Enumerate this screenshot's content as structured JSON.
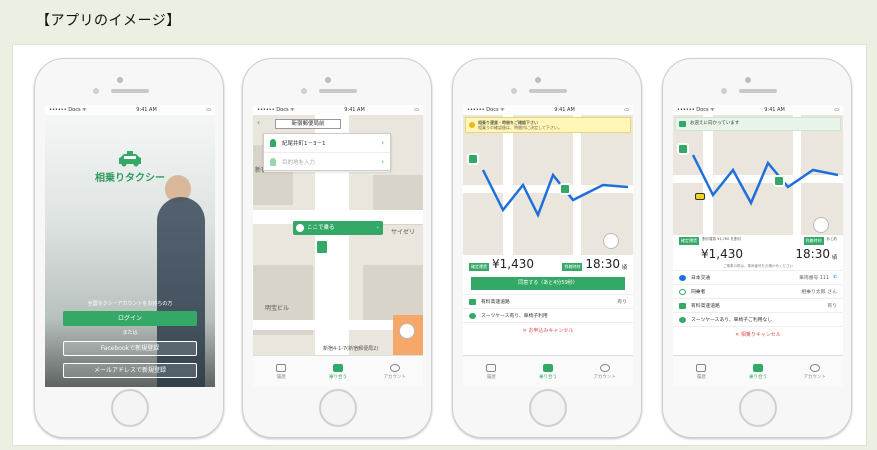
{
  "title": "【アプリのイメージ】",
  "colors": {
    "brand": "#34a866",
    "background": "#ecf0e2",
    "cancel": "#e05050",
    "notice": "#fff6b8"
  },
  "status": {
    "carrier": "•••••• Docs ᯤ",
    "time1": "9:41 AM",
    "time2": "9:41 AM",
    "time3": "9:41 AM",
    "time4": "9:41 AM"
  },
  "screen1": {
    "brand": "相乗りタクシー",
    "lead": "全国タクシーアカウントをお持ちの方",
    "login": "ログイン",
    "or": "または",
    "facebook": "Facebookで新規登録",
    "email": "メールアドレスで新規登録"
  },
  "screen2": {
    "title": "新宿郵便局前",
    "pickup": "紀尾井町1－3－1",
    "destination": "目的地を入力",
    "ride_here": "ここで乗る",
    "label_shin": "新宿",
    "label_saize": "サイゼリ",
    "label_building": "明宝ビル",
    "label_street": "新宿郵便局",
    "label_address": "新宿4-1-7(新宿郵便局2)"
  },
  "screen3": {
    "notice": "相乗り運賃・時間をご確認下さい",
    "notice_sub": "相乗りの確認後は、時間内に決定して下さい。",
    "fare_tag": "確定運賃",
    "time_tag": "到着時刻",
    "fare": "¥1,430",
    "time": "18:30",
    "time_suffix": "頃",
    "confirm": "同意する（あと4分59秒）",
    "opt_highway": "有料高速道路",
    "opt_highway_val": "有り",
    "opt_luggage": "スーツケース有り、車椅子利用",
    "cancel": "お申込みキャンセル",
    "tabs": [
      "履歴",
      "乗り合う",
      "アカウント"
    ]
  },
  "screen4": {
    "banner": "お迎えに向かっています",
    "fare_tag": "確定運賃",
    "fare_sub": "割引運賃 ¥1,760 を割引",
    "time_tag": "到着時刻",
    "time_sub": "あと約",
    "fare": "¥1,430",
    "time": "18:30",
    "time_suffix": "頃",
    "company_note": "ご乗車の際は、車両番号をお確かめください",
    "company": "日本交通",
    "car_no": "車両番号 111",
    "rider_label": "同乗者",
    "rider": "相乗り太郎",
    "rider_suffix": "さん",
    "opt_highway": "有料高速道路",
    "opt_highway_val": "有り",
    "opt_luggage": "スーツケースあり、車椅子ご利用なし",
    "cancel": "相乗りキャンセル",
    "tabs": [
      "履歴",
      "乗り合う",
      "アカウント"
    ]
  }
}
